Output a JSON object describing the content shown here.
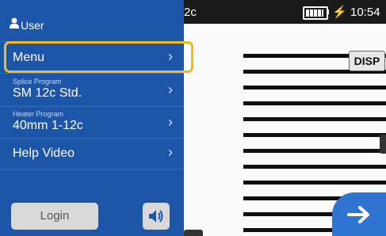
{
  "status_bar": {
    "program_abbrev": "2c",
    "clock": "10:54",
    "battery_icon": "battery-icon",
    "charging_icon": "charging-bolt-icon",
    "charge_symbol": "⚡"
  },
  "panel": {
    "user_label": "User",
    "user_icon": "person-icon",
    "items": [
      {
        "label": "Menu",
        "chevron": "›"
      },
      {
        "caption": "Splice Program",
        "label": "SM 12c Std.",
        "chevron": "›"
      },
      {
        "caption": "Heater Program",
        "label": "40mm 1-12c",
        "chevron": "›"
      },
      {
        "label": "Help Video",
        "chevron": "›"
      }
    ],
    "login_label": "Login",
    "speaker_icon": "speaker-icon"
  },
  "view": {
    "disp_label": "DISP",
    "next_icon": "arrow-right-icon"
  },
  "colors": {
    "panel_bg": "#1d56a8",
    "highlight": "#f6b81a",
    "next_button": "#2e74d0",
    "status_bar": "#1a1a1a"
  }
}
